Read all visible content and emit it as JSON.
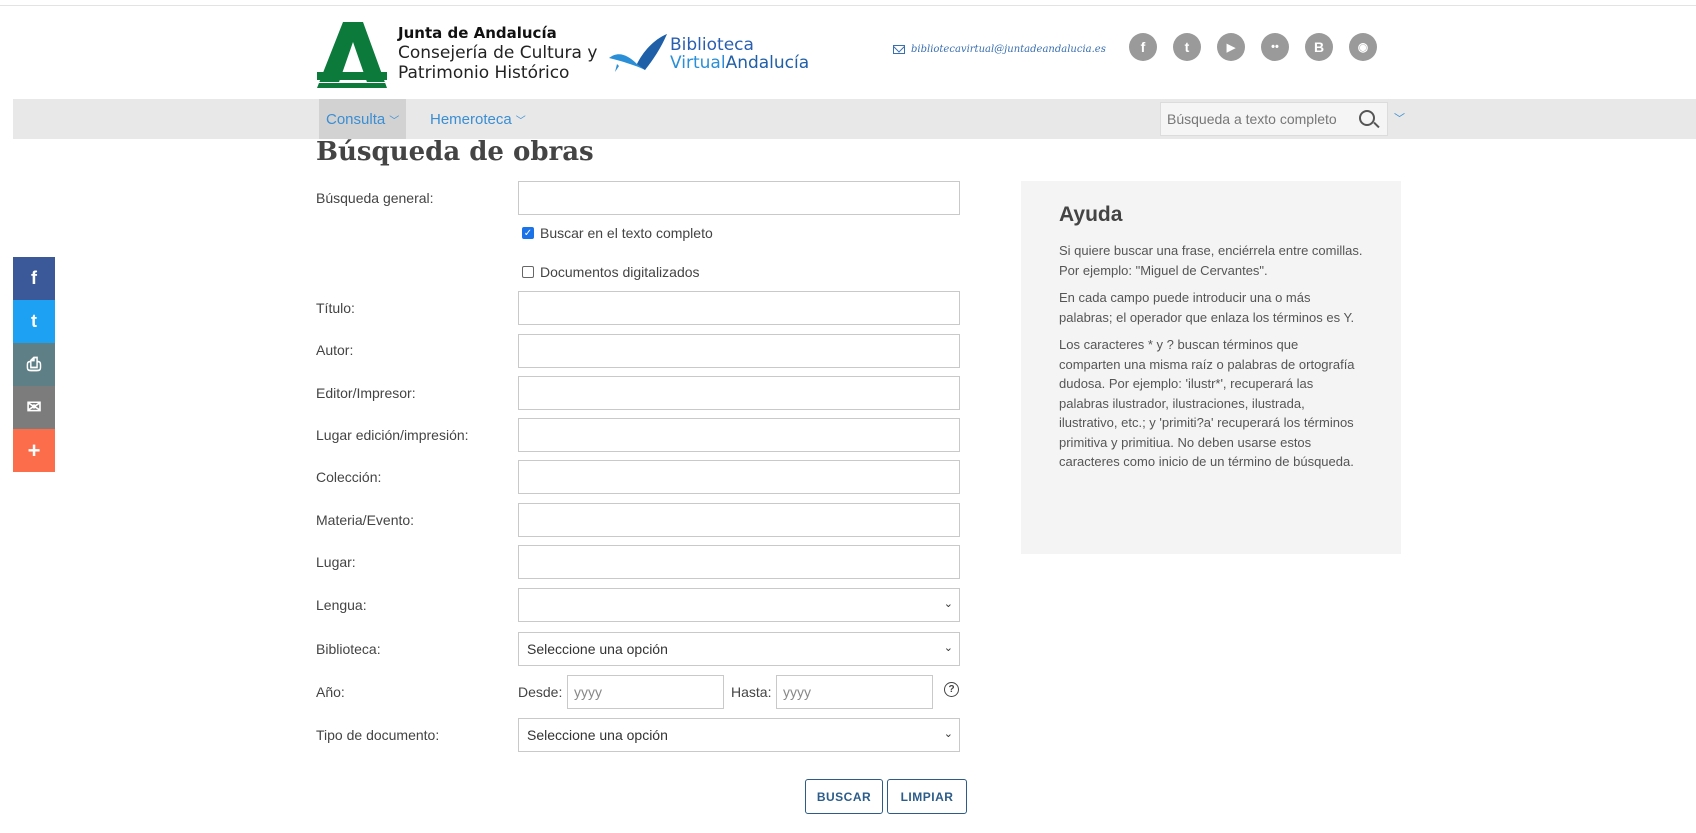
{
  "header": {
    "junta_line1": "Junta de Andalucía",
    "junta_line2": "Consejería de Cultura y",
    "junta_line3": "Patrimonio Histórico",
    "bva_line1": "Biblioteca",
    "bva_line2a": "Virtual",
    "bva_line2b": "Andalucía",
    "email": "bibliotecavirtual@juntadeandalucia.es",
    "socials": [
      {
        "icon": "facebook-icon",
        "glyph": "f"
      },
      {
        "icon": "twitter-icon",
        "glyph": "t"
      },
      {
        "icon": "youtube-icon",
        "glyph": "▶"
      },
      {
        "icon": "flickr-icon",
        "glyph": "••"
      },
      {
        "icon": "blogger-icon",
        "glyph": "B"
      },
      {
        "icon": "rss-icon",
        "glyph": "◉"
      }
    ],
    "social_color": "#9a9a9a"
  },
  "nav": {
    "consulta": "Consulta",
    "hemeroteca": "Hemeroteca",
    "search_placeholder": "Búsqueda a texto completo"
  },
  "share_bar": [
    {
      "icon": "facebook-icon",
      "glyph": "f",
      "color": "#3b5998"
    },
    {
      "icon": "twitter-icon",
      "glyph": "t",
      "color": "#1da1f2"
    },
    {
      "icon": "print-icon",
      "glyph": "⎙",
      "color": "#5f7f86"
    },
    {
      "icon": "email-icon",
      "glyph": "✉",
      "color": "#7c7c7c"
    },
    {
      "icon": "plus-icon",
      "glyph": "+",
      "color": "#fc6d4c"
    }
  ],
  "page": {
    "title": "Búsqueda de obras"
  },
  "form": {
    "general_label": "Búsqueda general:",
    "fulltext_label": "Buscar en el texto completo",
    "fulltext_checked": true,
    "digitized_label": "Documentos digitalizados",
    "digitized_checked": false,
    "titulo_label": "Título:",
    "autor_label": "Autor:",
    "editor_label": "Editor/Impresor:",
    "lugar_edicion_label": "Lugar edición/impresión:",
    "coleccion_label": "Colección:",
    "materia_label": "Materia/Evento:",
    "lugar_label": "Lugar:",
    "lengua_label": "Lengua:",
    "lengua_value": "",
    "biblioteca_label": "Biblioteca:",
    "biblioteca_value": "Seleccione una opción",
    "anio_label": "Año:",
    "desde_label": "Desde:",
    "desde_placeholder": "yyyy",
    "hasta_label": "Hasta:",
    "hasta_placeholder": "yyyy",
    "tipo_label": "Tipo de documento:",
    "tipo_value": "Seleccione una opción",
    "buscar_button": "BUSCAR",
    "limpiar_button": "LIMPIAR"
  },
  "help": {
    "title": "Ayuda",
    "p1": "Si quiere buscar una frase, enciérrela entre comillas. Por ejemplo: \"Miguel de Cervantes\".",
    "p2": "En cada campo puede introducir una o más palabras; el operador que enlaza los términos es Y.",
    "p3": "Los caracteres * y ? buscan términos que comparten una misma raíz o palabras de ortografía dudosa. Por ejemplo: 'ilustr*', recuperará las palabras ilustrador, ilustraciones, ilustrada, ilustrativo, etc.; y 'primiti?a' recuperará los términos primitiva y primitiua. No deben usarse estos caracteres como inicio de un término de búsqueda."
  },
  "colors": {
    "junta_green": "#0b7a3b",
    "link_blue": "#3a8ed4",
    "button_blue": "#2b5c8a"
  }
}
